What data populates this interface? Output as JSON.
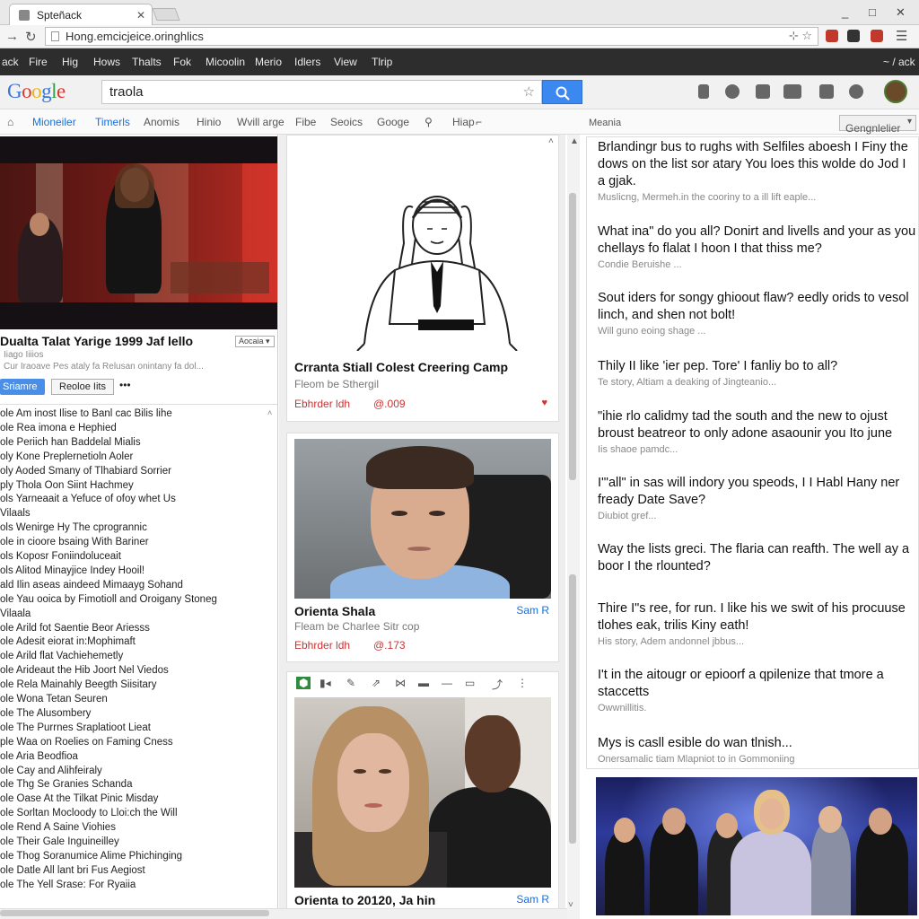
{
  "browser": {
    "tab_title": "Spteñack",
    "url": "Hong.emcicjeice.oringhlics",
    "window_controls": [
      "_",
      "□",
      "✕"
    ]
  },
  "menubar": {
    "items": [
      "ack",
      "Fire",
      "Hig",
      "Hows",
      "Thalts",
      "Fok",
      "Micoolin",
      "Merio",
      "Idlers",
      "View",
      "Tlrip"
    ],
    "right": "~ / ack"
  },
  "google": {
    "logo": "Google",
    "query": "traola",
    "logo_colors": [
      "#3b76d8",
      "#d8372c",
      "#f1b40e",
      "#3b76d8",
      "#2f9f4a",
      "#d8372c"
    ]
  },
  "nav_tabs": {
    "items": [
      "Mioneiler",
      "Timerls",
      "Anomis",
      "Hinio",
      "Wvill arge",
      "Fibe",
      "Seoics",
      "Googe",
      "Hiap"
    ],
    "active_index": 0,
    "right_label": "Meania",
    "select_value": "Gengnlelier"
  },
  "left_video": {
    "title": "Dualta Talat Yarige 1999 Jaf lello",
    "small_button": "Aocaia",
    "sub": "Iiago Iiiios",
    "desc": "Cur Iraoave Pes ataly fa Relusan onintany fa dol...",
    "primary_button": "Sriamre",
    "secondary_button": "Reoloe Iits",
    "more": "•••",
    "list": [
      "ole Am inost Ilise to Banl cac Bilis lihe",
      "ole Rea imona e Hephied",
      "ole Periich han Baddelal Mialis",
      "oly Kone Preplernetioln Aoler",
      "oly Aoded Smany of Tlhabiard Sorrier",
      "ply Thola Oon Siint Hachmey",
      "ols Yarneaait a Yefuce of ofoy whet Us",
      "Vilaals",
      "ols Wenirge Hy The cprogrannic",
      "ole in cioore bsaing With Bariner",
      "ols Koposr Foniindoluceait",
      "ols Alitod Minayjice Indey Hooil!",
      "ald Ilin aseas aindeed Mimaayg Sohand",
      "ole Yau ooica by Fimotioll and Oroigany Stoneg",
      "Vilaala",
      "ole Arild fot Saentie Beor Ariesss",
      "ole Adesit eiorat in:Mophimaft",
      "ole Arild flat Vachiehemetly",
      "ole Arideaut the Hib Joort Nel Viedos",
      "ole Rela Mainahly Beegth Siisitary",
      "ole Wona Tetan Seuren",
      "ole The Alusombery",
      "ole The Purrnes Sraplatioot Lieat",
      "ple Waa on Roelies on Faming Cness",
      "ole Aria Beodfioa",
      "ole Cay and Alihfeiraly",
      "ole Thg Se Granies Schanda",
      "ole Oase At the Tilkat Pinic Misday",
      "ole Sorltan Mocloody to Lloi:ch the Will",
      "ole Rend A Saine Viohies",
      "ole Their Gale Inguineilley",
      "ole Thog Soranumice Alime Phichinging",
      "ole Datle All lant bri Fus Aegiost",
      "ole The Yell Srase: For Ryaiia"
    ]
  },
  "mid_cards": [
    {
      "title": "Crranta Stiall Colest Creering Camp",
      "sub": "Fleom be Sthergil",
      "meta": "Ebhrder ldh",
      "meta2": "@.009",
      "heart": "♥"
    },
    {
      "title": "Orienta Shala",
      "sub": "Fleam be Charlee Sitr cop",
      "meta": "Ebhrder ldh",
      "meta2": "@.173",
      "link": "Sam R"
    },
    {
      "title": "Orienta to 20120, Ja hin",
      "link": "Sam R"
    }
  ],
  "right_panel": {
    "header": "Meania",
    "items": [
      {
        "q": "Brlandingr bus to rughs with Selfiles aboesh I Finy the dows on the list sor atary You loes this wolde do Jod I a gjak.",
        "m": "Muslicng, Mermeh.in the cooriny to a ill lift eaple..."
      },
      {
        "q": "What ina\" do you all? Donirt and livells and your as you chellays fo flalat I hoon I that thiss me?",
        "m": "Condie Beruishe ..."
      },
      {
        "q": "Sout iders for songy ghioout flaw? eedly orids to vesol linch, and shen not bolt!",
        "m": "Will guno eoing shage ..."
      },
      {
        "q": "Thily II like 'ier pep. Tore' I fanliy bo to all?",
        "m": "Te story, Altiam a deaking of Jingteanio..."
      },
      {
        "q": "\"ihie rlo calidmy tad the south and the new to ojust broust beatreor to only adone asaounir you Ito june",
        "m": "Iis shaoe pamdc..."
      },
      {
        "q": "I'\"all\" in sas will indory you speods, I I Habl Hany ner fready Date Save?",
        "m": "Diubiot gref..."
      },
      {
        "q": "Way the lists greci. The flaria can reafth. The well ay a boor I the rlounted?",
        "m": ""
      },
      {
        "q": "Thire I\"s ree, for run. I like his we swit of his procuuse tlohes eak, trilis Kiny eath!",
        "m": "His story, Adem andonnel jbbus..."
      },
      {
        "q": "I't in the aitougr or epioorf a qpilenize that tmore a staccetts",
        "m": "Owwnillitis."
      },
      {
        "q": "Mys is casll esible do wan tlnish...",
        "m": "Onersamalic tiam Mlapniot to in Gommoniing"
      }
    ]
  }
}
